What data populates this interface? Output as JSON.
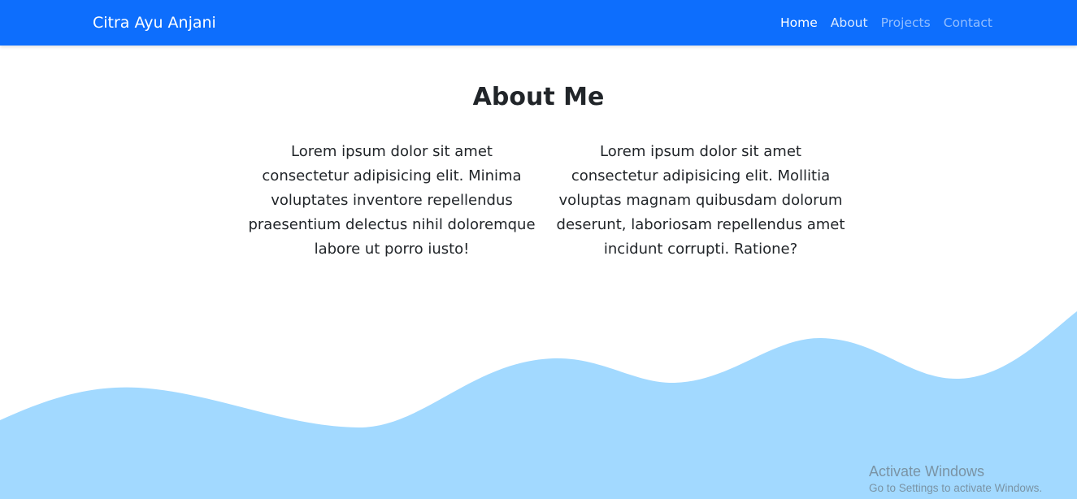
{
  "navbar": {
    "brand": "Citra Ayu Anjani",
    "links": [
      {
        "label": "Home"
      },
      {
        "label": "About"
      },
      {
        "label": "Projects"
      },
      {
        "label": "Contact"
      }
    ],
    "color": "#0d6efd"
  },
  "about": {
    "title": "About Me",
    "paragraphs": [
      "Lorem ipsum dolor sit amet consectetur adipisicing elit. Minima voluptates inventore repellendus praesentium delectus nihil doloremque labore ut porro iusto!",
      "Lorem ipsum dolor sit amet consectetur adipisicing elit. Mollitia voluptas magnam quibusdam dolorum deserunt, laboriosam repellendus amet incidunt corrupti. Ratione?"
    ]
  },
  "wave": {
    "color": "#a2d9ff"
  },
  "watermark": {
    "title": "Activate Windows",
    "subtitle": "Go to Settings to activate Windows."
  }
}
